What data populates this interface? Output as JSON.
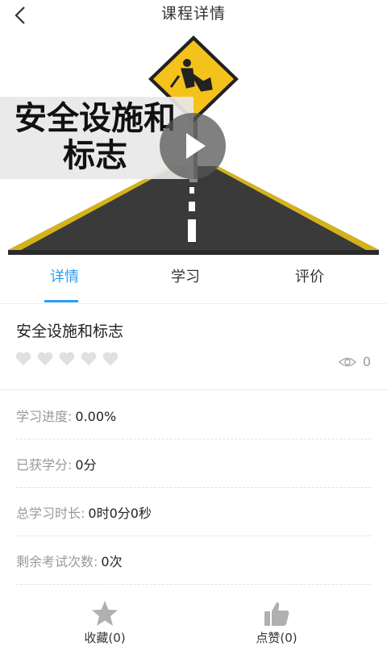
{
  "header": {
    "title": "课程详情",
    "back_icon": "chevron-left-icon"
  },
  "hero": {
    "banner_line1": "安全设施和",
    "banner_line2": "标志",
    "play_icon": "play-icon"
  },
  "tabs": [
    {
      "label": "详情",
      "active": true
    },
    {
      "label": "学习",
      "active": false
    },
    {
      "label": "评价",
      "active": false
    }
  ],
  "course": {
    "title": "安全设施和标志",
    "rating": 0,
    "rating_max": 5,
    "views": "0"
  },
  "stats": [
    {
      "label": "学习进度:",
      "value": "0.00%"
    },
    {
      "label": "已获学分:",
      "value": "0分"
    },
    {
      "label": "总学习时长:",
      "value": "0时0分0秒"
    },
    {
      "label": "剩余考试次数:",
      "value": "0次"
    }
  ],
  "bottom": {
    "favorite_label": "收藏(0)",
    "like_label": "点赞(0)"
  },
  "colors": {
    "accent": "#2a9df4",
    "sign_yellow": "#f5c21b",
    "road": "#3a3a3a"
  }
}
